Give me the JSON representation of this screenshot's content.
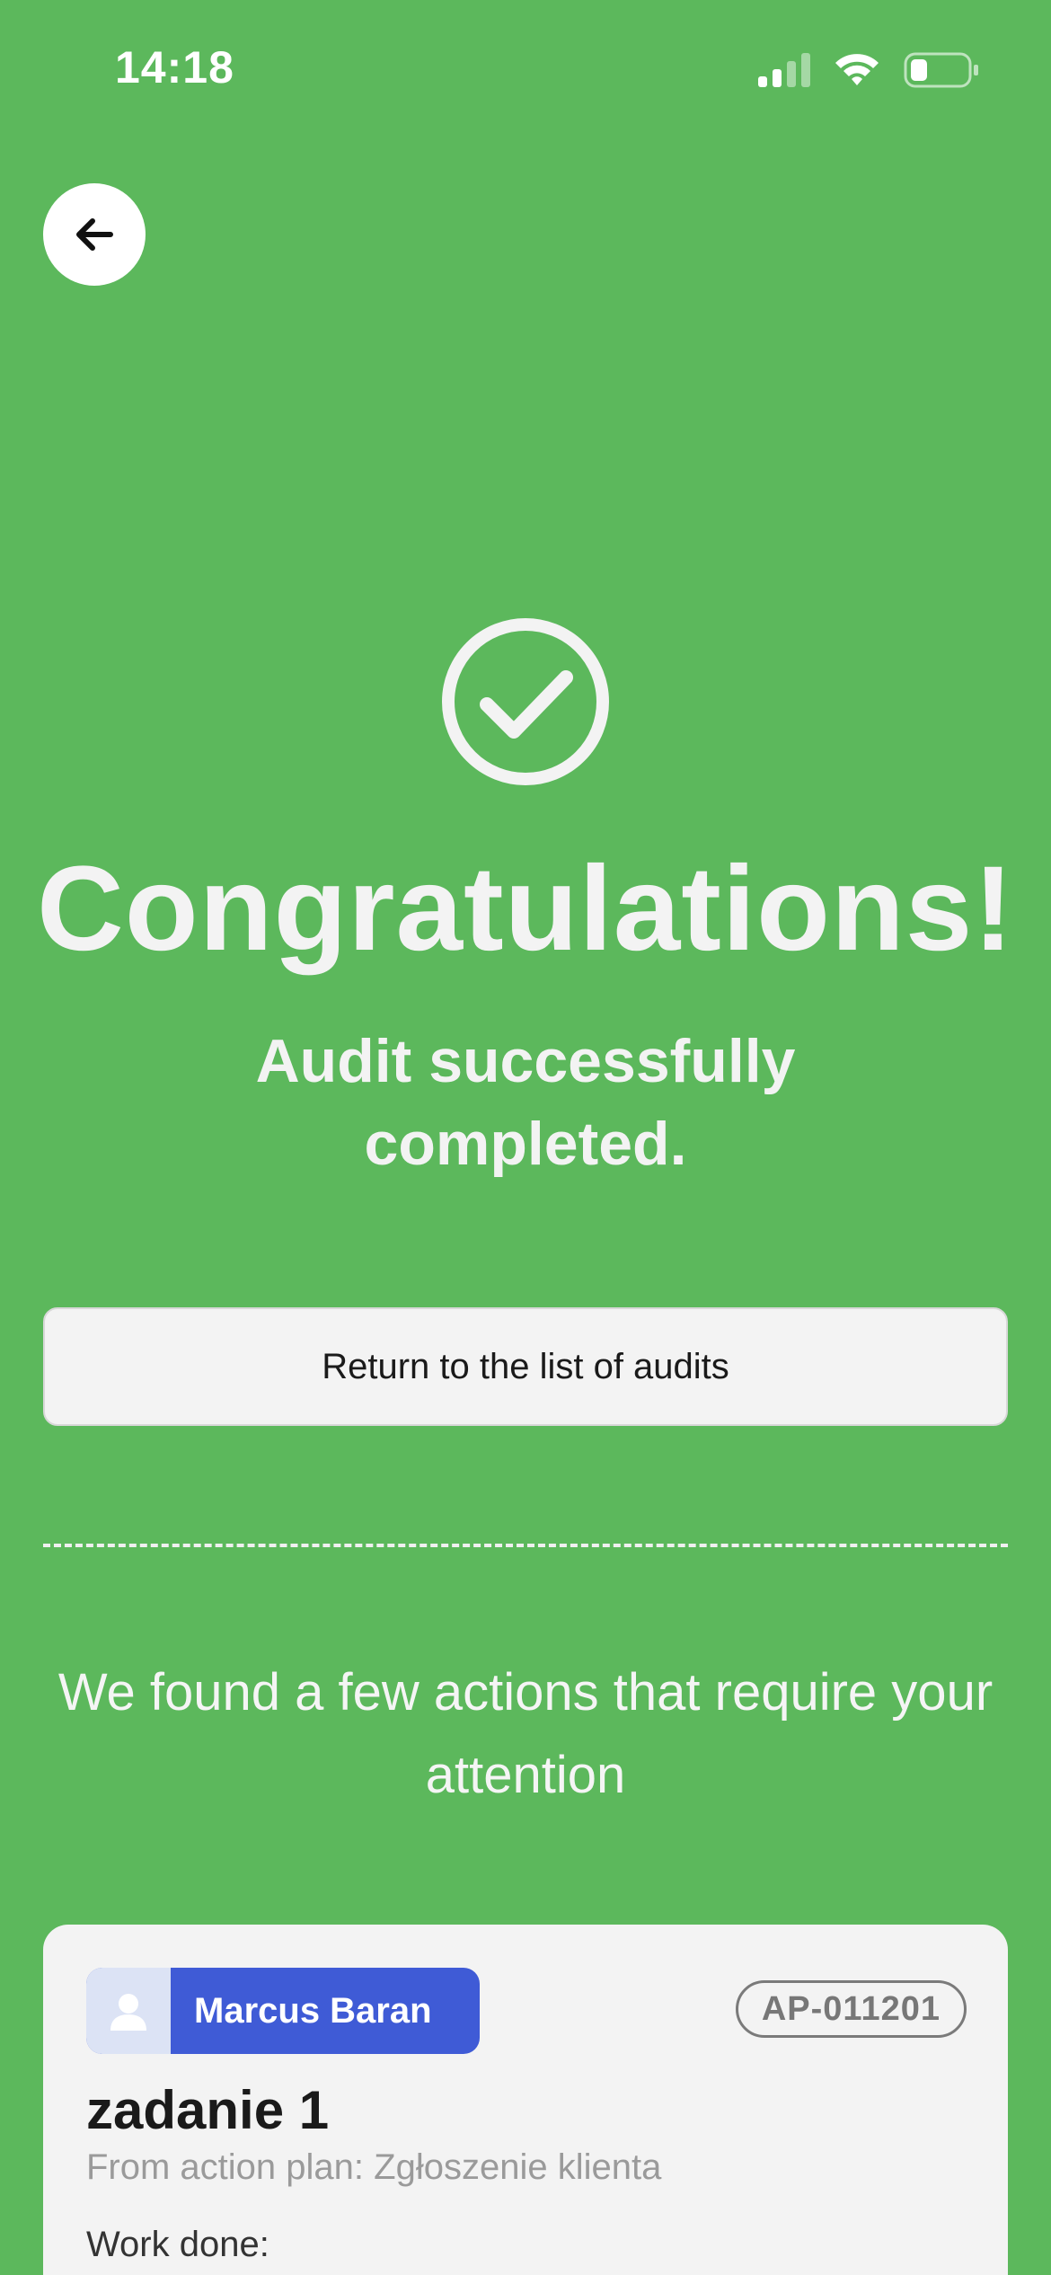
{
  "status_bar": {
    "time": "14:18",
    "signal_icon": "cellular-signal-icon",
    "wifi_icon": "wifi-icon",
    "battery_icon": "battery-icon"
  },
  "navigation": {
    "back_icon": "arrow-left-icon"
  },
  "success": {
    "icon": "check-circle-icon",
    "headline": "Congratulations!",
    "subheadline": "Audit successfully completed."
  },
  "actions": {
    "return_label": "Return to the list of audits"
  },
  "attention": {
    "message": "We found a few actions that require your attention"
  },
  "action_card": {
    "assignee_icon": "user-avatar-icon",
    "assignee_name": "Marcus Baran",
    "code": "AP-011201",
    "title": "zadanie 1",
    "from_plan": "From action plan: Zgłoszenie klienta",
    "work_done_label": "Work done:"
  },
  "colors": {
    "background": "#5CB85C",
    "card": "#F3F3F3",
    "assignee_badge": "#3F5BD6"
  }
}
